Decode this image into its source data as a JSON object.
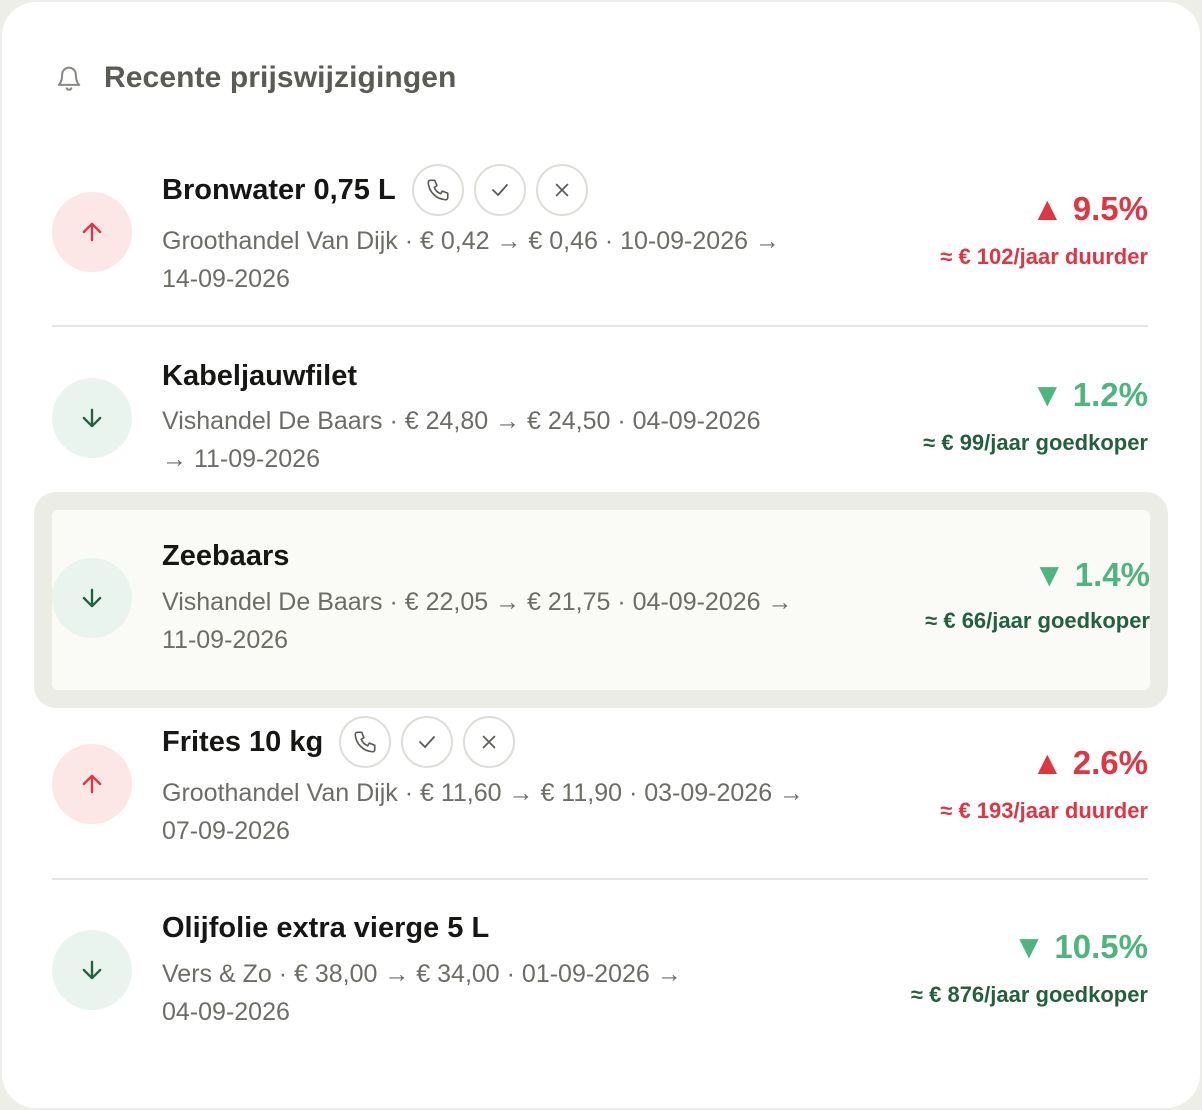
{
  "header": {
    "title": "Recente prijswijzigingen",
    "icon": "bell-icon"
  },
  "colors": {
    "up": "#e03543",
    "down": "#4fb57f",
    "down_text": "#245f3e"
  },
  "items": [
    {
      "direction": "up",
      "title": "Bronwater 0,75 L",
      "has_actions": true,
      "subtitle_line1": "Groothandel Van Dijk · € 0,42 → € 0,46 · 10-09-2026 →",
      "subtitle_line2": "14-09-2026",
      "change": "▲ 9.5%",
      "yearly": "≈ € 102/jaar duurder"
    },
    {
      "direction": "down",
      "title": "Kabeljauwfilet",
      "has_actions": false,
      "subtitle_line1": "Vishandel De Baars · € 24,80 → € 24,50 · 04-09-2026",
      "subtitle_line2": "→ 11-09-2026",
      "change": "▼ 1.2%",
      "yearly": "≈ € 99/jaar goedkoper"
    },
    {
      "direction": "down",
      "title": "Zeebaars",
      "has_actions": false,
      "highlighted": true,
      "subtitle_line1": "Vishandel De Baars · € 22,05 → € 21,75 · 04-09-2026 →",
      "subtitle_line2": "11-09-2026",
      "change": "▼ 1.4%",
      "yearly": "≈ € 66/jaar goedkoper"
    },
    {
      "direction": "up",
      "title": "Frites 10 kg",
      "has_actions": true,
      "subtitle_line1": "Groothandel Van Dijk · € 11,60 → € 11,90 · 03-09-2026 →",
      "subtitle_line2": "07-09-2026",
      "change": "▲ 2.6%",
      "yearly": "≈ € 193/jaar duurder"
    },
    {
      "direction": "down",
      "title": "Olijfolie extra vierge 5 L",
      "has_actions": false,
      "subtitle_line1": "Vers & Zo · € 38,00 → € 34,00 · 01-09-2026 →",
      "subtitle_line2": "04-09-2026",
      "change": "▼ 10.5%",
      "yearly": "≈ € 876/jaar goedkoper"
    }
  ]
}
